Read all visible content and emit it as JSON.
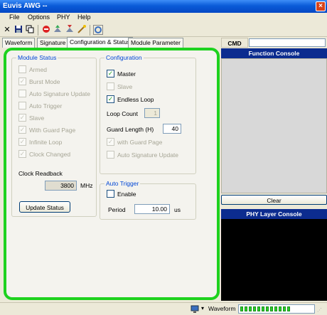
{
  "window": {
    "title": "Euvis AWG --"
  },
  "menu": {
    "file": "File",
    "options": "Options",
    "phy": "PHY",
    "help": "Help"
  },
  "tabs": [
    "Waveform",
    "Signature",
    "Configuration & Status",
    "Module Parameter"
  ],
  "module_status": {
    "title": "Module Status",
    "items": [
      {
        "label": "Armed",
        "checked": false
      },
      {
        "label": "Burst Mode",
        "checked": true
      },
      {
        "label": "Auto Signature Update",
        "checked": false
      },
      {
        "label": "Auto Trigger",
        "checked": false
      },
      {
        "label": "Slave",
        "checked": true
      },
      {
        "label": "With Guard Page",
        "checked": true
      },
      {
        "label": "Infinite Loop",
        "checked": true
      },
      {
        "label": "Clock Changed",
        "checked": true
      }
    ],
    "clock_label": "Clock Readback",
    "clock_value": "3800",
    "clock_unit": "MHz",
    "update_button": "Update Status"
  },
  "configuration": {
    "title": "Configuration",
    "master": "Master",
    "slave": "Slave",
    "endless_loop": "Endless Loop",
    "loop_count_label": "Loop Count",
    "loop_count_value": "1",
    "guard_length_label": "Guard Length (H)",
    "guard_length_value": "40",
    "with_guard_page": "with Guard Page",
    "auto_signature_update": "Auto Signature Update"
  },
  "auto_trigger": {
    "title": "Auto Trigger",
    "enable": "Enable",
    "period_label": "Period",
    "period_value": "10.00",
    "period_unit": "us"
  },
  "right_panel": {
    "cmd_label": "CMD",
    "function_console": "Function Console",
    "clear_button": "Clear",
    "phy_console": "PHY Layer Console"
  },
  "statusbar": {
    "waveform_label": "Waveform"
  },
  "colors": {
    "highlight": "#1ed21e",
    "console_header": "#0c2c8f",
    "group_title": "#0046d5"
  }
}
